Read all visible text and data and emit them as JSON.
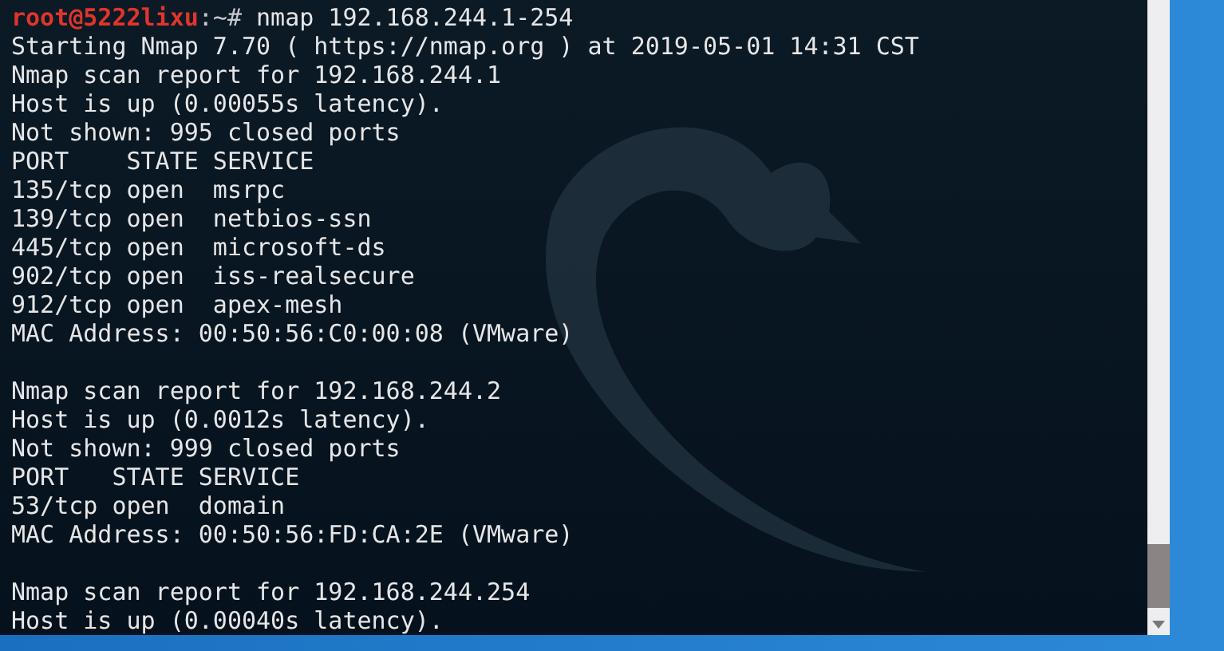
{
  "terminal": {
    "prompt": {
      "user_host": "root@5222lixu",
      "path": ":~#"
    },
    "command": "nmap 192.168.244.1-254",
    "blocks": [
      {
        "lines": [
          "Starting Nmap 7.70 ( https://nmap.org ) at 2019-05-01 14:31 CST",
          "Nmap scan report for 192.168.244.1",
          "Host is up (0.00055s latency).",
          "Not shown: 995 closed ports",
          "PORT    STATE SERVICE",
          "135/tcp open  msrpc",
          "139/tcp open  netbios-ssn",
          "445/tcp open  microsoft-ds",
          "902/tcp open  iss-realsecure",
          "912/tcp open  apex-mesh",
          "MAC Address: 00:50:56:C0:00:08 (VMware)"
        ]
      },
      {
        "lines": [
          "Nmap scan report for 192.168.244.2",
          "Host is up (0.0012s latency).",
          "Not shown: 999 closed ports",
          "PORT   STATE SERVICE",
          "53/tcp open  domain",
          "MAC Address: 00:50:56:FD:CA:2E (VMware)"
        ]
      },
      {
        "lines": [
          "Nmap scan report for 192.168.244.254",
          "Host is up (0.00040s latency)."
        ]
      }
    ]
  }
}
